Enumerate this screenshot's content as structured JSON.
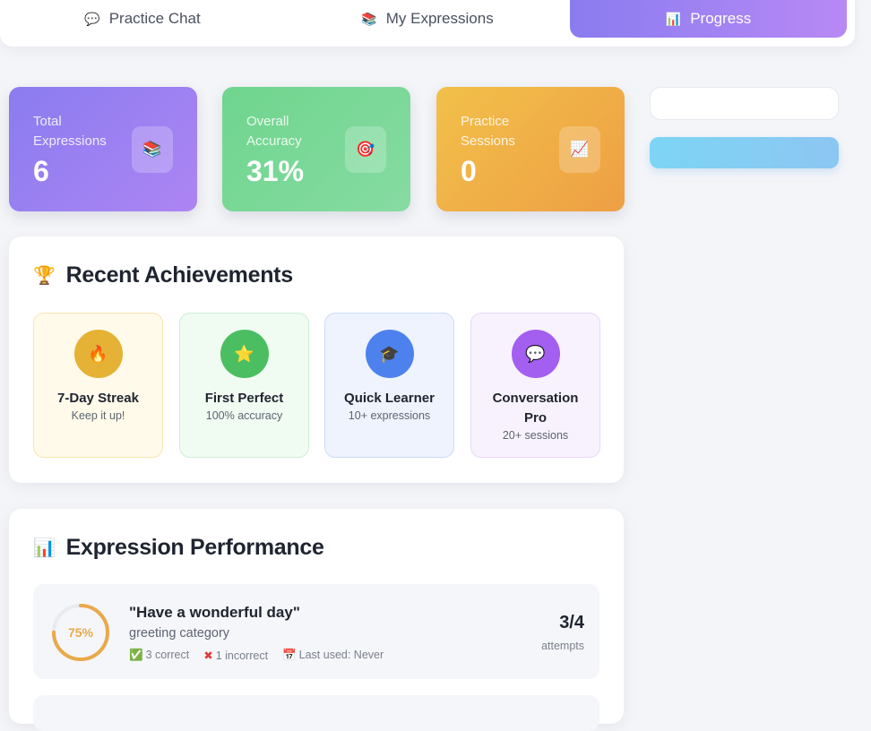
{
  "tabs": [
    {
      "label": "Practice Chat",
      "icon": "💬"
    },
    {
      "label": "My Expressions",
      "icon": "📚"
    },
    {
      "label": "Progress",
      "icon": "📊",
      "active": true
    }
  ],
  "stats": [
    {
      "label": "Total Expressions",
      "value": "6",
      "icon": "📚"
    },
    {
      "label": "Overall Accuracy",
      "value": "31%",
      "icon": "🎯"
    },
    {
      "label": "Practice Sessions",
      "value": "0",
      "icon": "📈"
    }
  ],
  "achievements": {
    "title": "Recent Achievements",
    "icon": "🏆",
    "items": [
      {
        "name": "7-Day Streak",
        "sub": "Keep it up!",
        "icon": "🔥"
      },
      {
        "name": "First Perfect",
        "sub": "100% accuracy",
        "icon": "⭐"
      },
      {
        "name": "Quick Learner",
        "sub": "10+ expressions",
        "icon": "🎓"
      },
      {
        "name": "Conversation Pro",
        "sub": "20+ sessions",
        "icon": "💬"
      }
    ]
  },
  "performance": {
    "title": "Expression Performance",
    "icon": "📊",
    "rows": [
      {
        "percent_label": "75%",
        "accuracy": 0.75,
        "expression": "\"Have a wonderful day\"",
        "category": "greeting category",
        "correct": "3 correct",
        "incorrect": "1 incorrect",
        "last_used": "Last used: Never",
        "count": "3/4",
        "count_label": "attempts"
      }
    ]
  },
  "colors": {
    "accent_purple": "#8a7cf0",
    "accent_green": "#6fd58d",
    "accent_orange": "#ee9f44",
    "ring": "#e9a94a"
  }
}
